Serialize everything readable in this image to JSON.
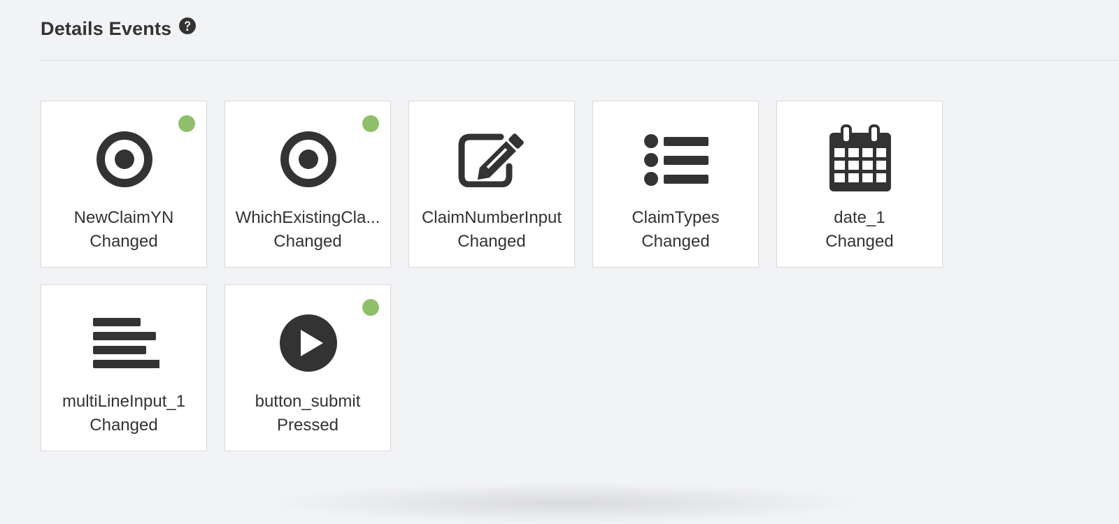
{
  "header": {
    "title": "Details Events",
    "help_icon": "question-circle-icon"
  },
  "colors": {
    "icon": "#333333",
    "active_dot": "#8fbf6a",
    "tile_border": "#d8d9dc",
    "background": "#f2f3f5"
  },
  "events": [
    {
      "name": "NewClaimYN",
      "action": "Changed",
      "icon": "radio-button-icon",
      "active": true
    },
    {
      "name": "WhichExistingCla...",
      "action": "Changed",
      "icon": "radio-button-icon",
      "active": true
    },
    {
      "name": "ClaimNumberInput",
      "action": "Changed",
      "icon": "edit-icon",
      "active": false
    },
    {
      "name": "ClaimTypes",
      "action": "Changed",
      "icon": "list-icon",
      "active": false
    },
    {
      "name": "date_1",
      "action": "Changed",
      "icon": "calendar-icon",
      "active": false
    },
    {
      "name": "multiLineInput_1",
      "action": "Changed",
      "icon": "multiline-text-icon",
      "active": false
    },
    {
      "name": "button_submit",
      "action": "Pressed",
      "icon": "play-button-icon",
      "active": true
    }
  ]
}
